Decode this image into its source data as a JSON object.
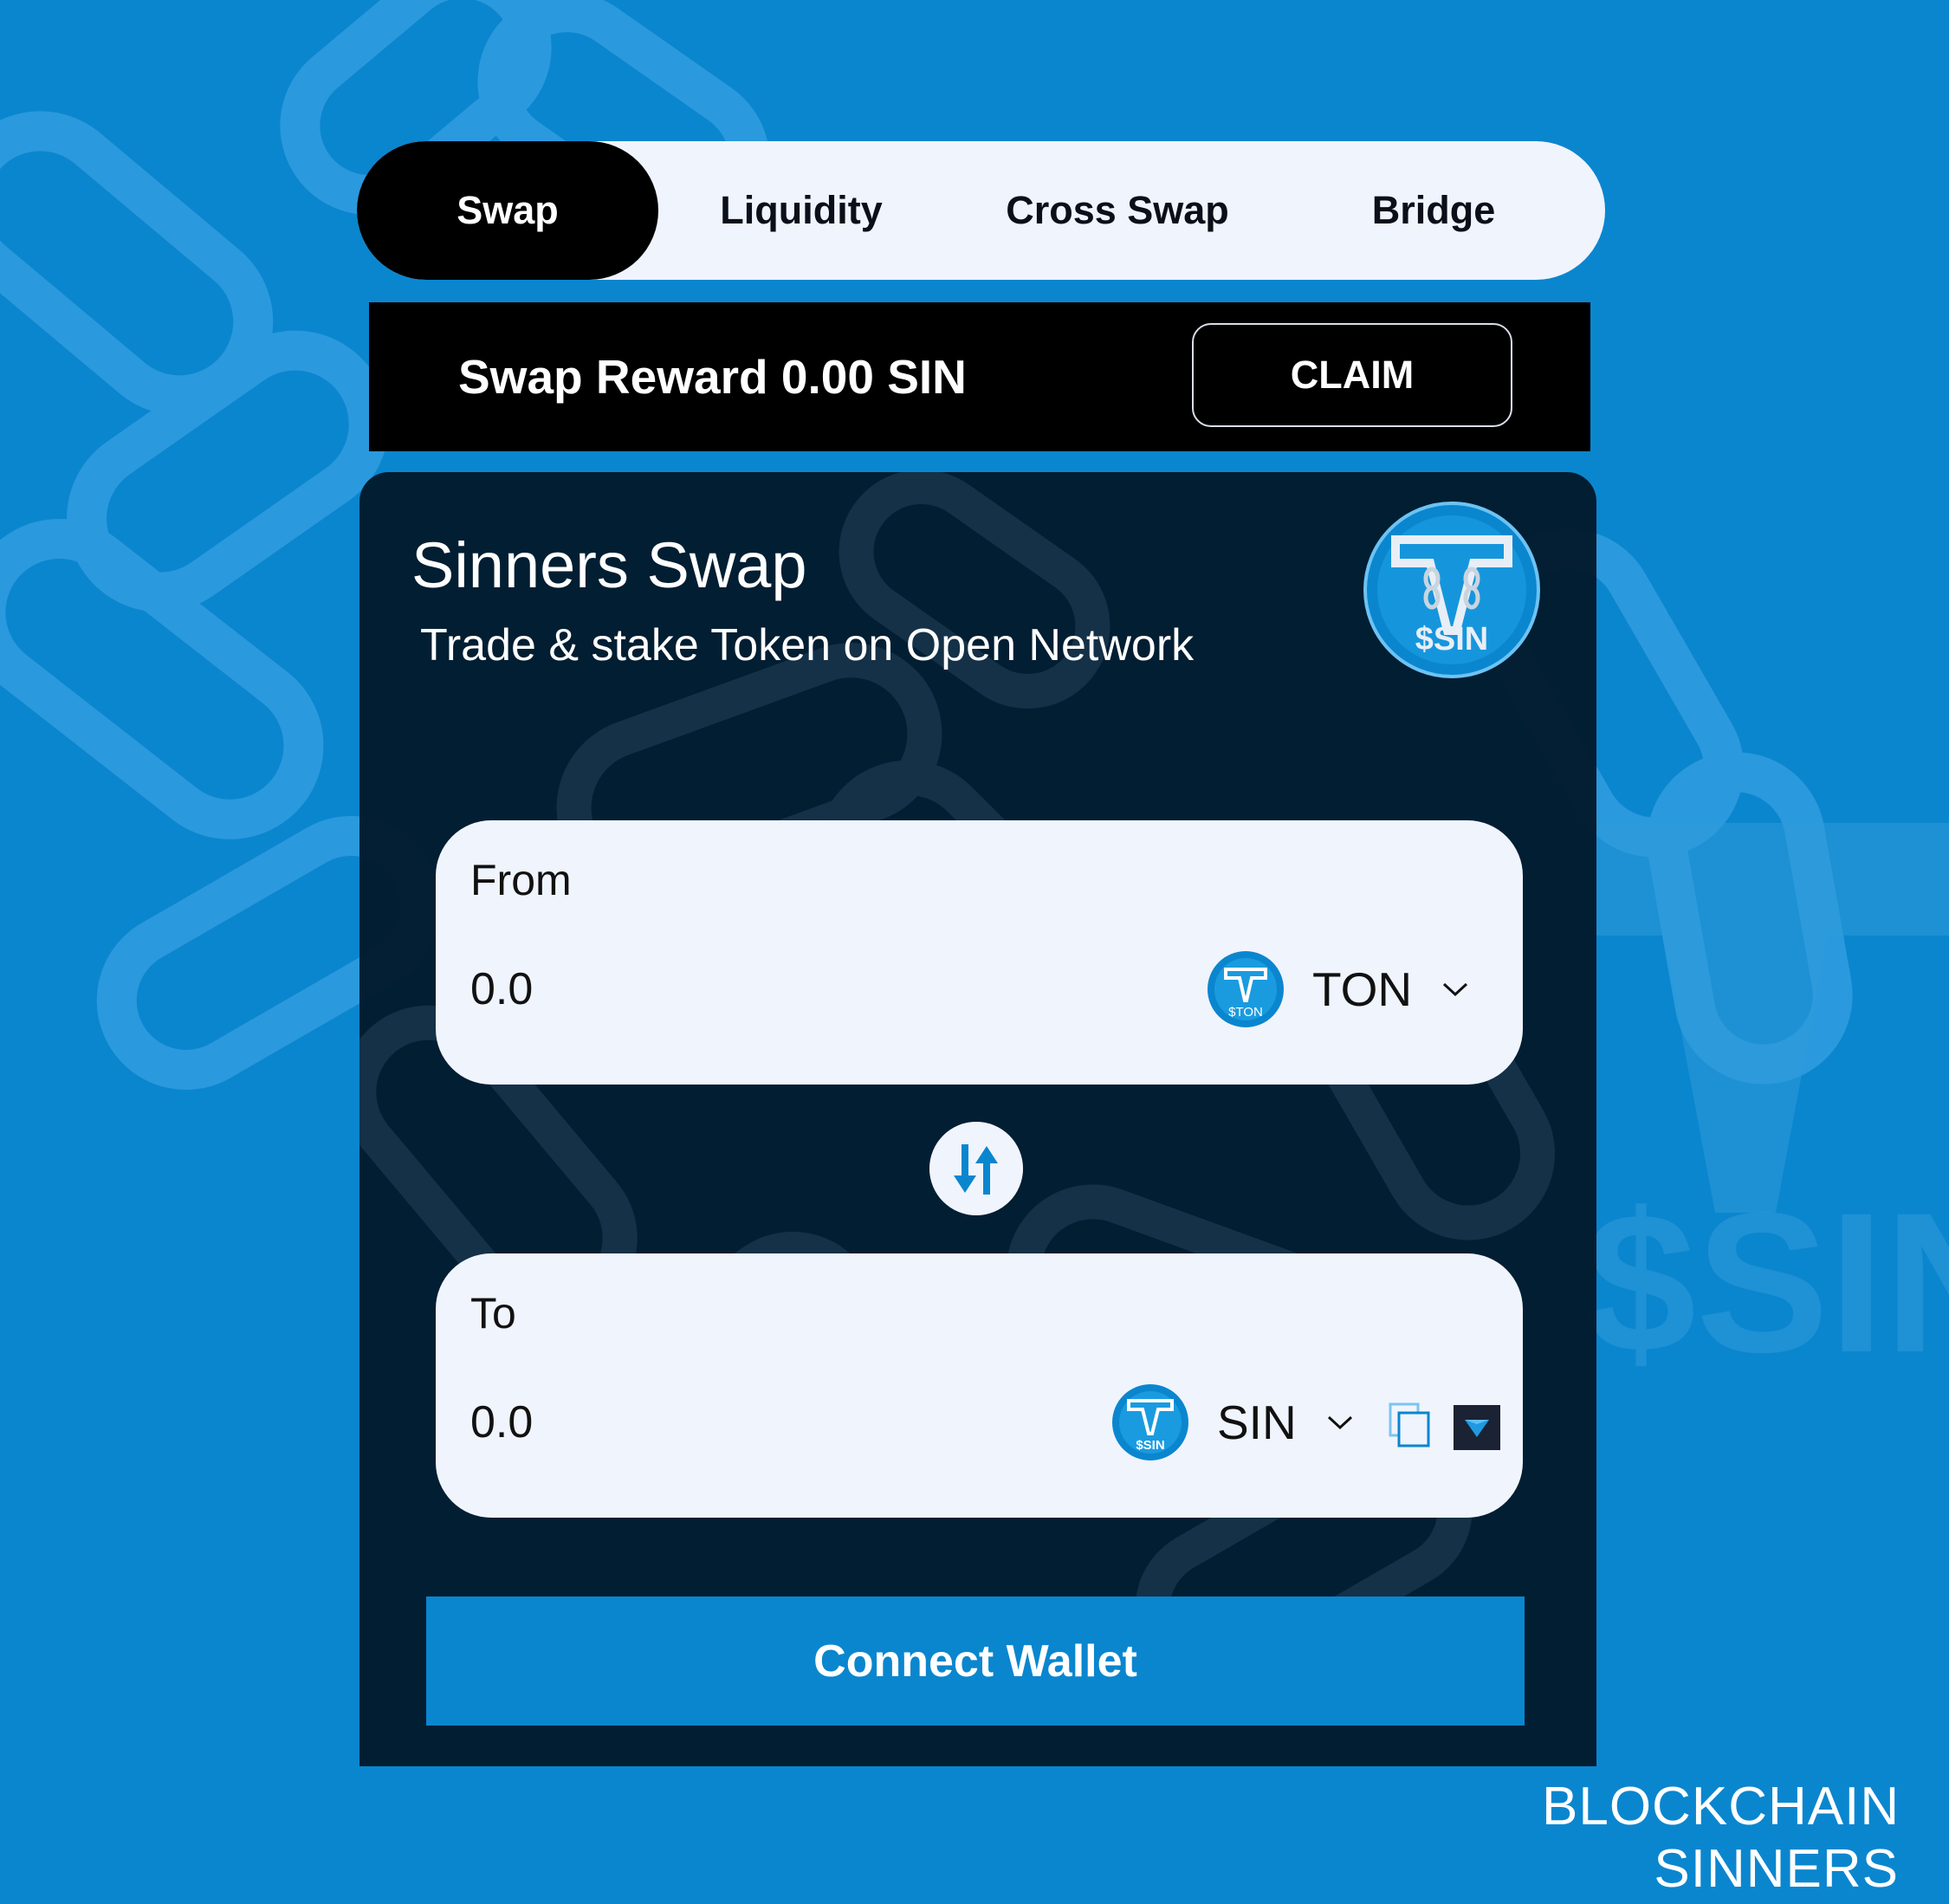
{
  "tabs": [
    {
      "label": "Swap",
      "active": true
    },
    {
      "label": "Liquidity",
      "active": false
    },
    {
      "label": "Cross Swap",
      "active": false
    },
    {
      "label": "Bridge",
      "active": false
    }
  ],
  "reward": {
    "text": "Swap Reward 0.00 SIN",
    "claim_label": "CLAIM"
  },
  "card": {
    "title": "Sinners Swap",
    "subtitle": "Trade & stake Token on Open Network",
    "logo_text": "$SIN"
  },
  "from": {
    "label": "From",
    "amount": "0.0",
    "token": "TON",
    "token_icon_text": "$TON",
    "icon": "ton-token-icon"
  },
  "to": {
    "label": "To",
    "amount": "0.0",
    "token": "SIN",
    "token_icon_text": "$SIN",
    "icon": "sin-token-icon"
  },
  "connect_wallet_label": "Connect Wallet",
  "branding": {
    "line1": "BLOCKCHAIN",
    "line2": "SINNERS"
  },
  "colors": {
    "background": "#0a86cf",
    "card": "#021728",
    "panel": "#f0f4fd",
    "accent": "#0a86cf",
    "active_tab": "#000000"
  }
}
